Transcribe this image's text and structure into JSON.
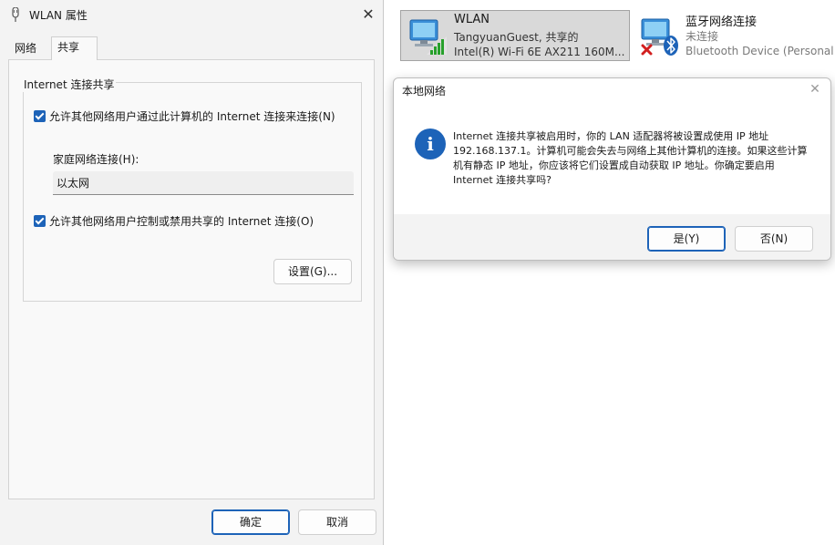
{
  "props_window": {
    "title": "WLAN 属性",
    "close_glyph": "✕",
    "tabs": [
      {
        "label": "网络"
      },
      {
        "label": "共享"
      }
    ],
    "group_title": "Internet 连接共享",
    "allow_connect_label": "允许其他网络用户通过此计算机的 Internet 连接来连接(N)",
    "allow_connect_checked": true,
    "home_network_label": "家庭网络连接(H):",
    "home_network_value": "以太网",
    "allow_control_label": "允许其他网络用户控制或禁用共享的 Internet 连接(O)",
    "allow_control_checked": true,
    "settings_button": "设置(G)...",
    "ok_button": "确定",
    "cancel_button": "取消"
  },
  "network_tiles": [
    {
      "name": "WLAN",
      "status": "TangyuanGuest, 共享的",
      "device": "Intel(R) Wi-Fi 6E AX211 160M...",
      "icon": "wifi-adapter-icon"
    },
    {
      "name": "蓝牙网络连接",
      "status": "未连接",
      "device": "Bluetooth Device (Personal A",
      "icon": "bluetooth-adapter-icon"
    }
  ],
  "dialog": {
    "title": "本地网络",
    "close_glyph": "✕",
    "icon": "info-icon",
    "icon_glyph": "i",
    "message_lines": [
      "Internet 连接共享被启用时，你的 LAN 适配器将被设置成使用 IP 地址",
      "192.168.137.1。计算机可能会失去与网络上其他计算机的连接。如果这些计算",
      "机有静态 IP 地址，你应该将它们设置成自动获取 IP 地址。你确定要启用",
      "Internet 连接共享吗?"
    ],
    "yes_button": "是(Y)",
    "no_button": "否(N)"
  },
  "colors": {
    "accent": "#1d63b8",
    "window_bg": "#f3f3f3",
    "tile_selected_bg": "#d9d9d9",
    "error_red": "#d21f1f"
  }
}
